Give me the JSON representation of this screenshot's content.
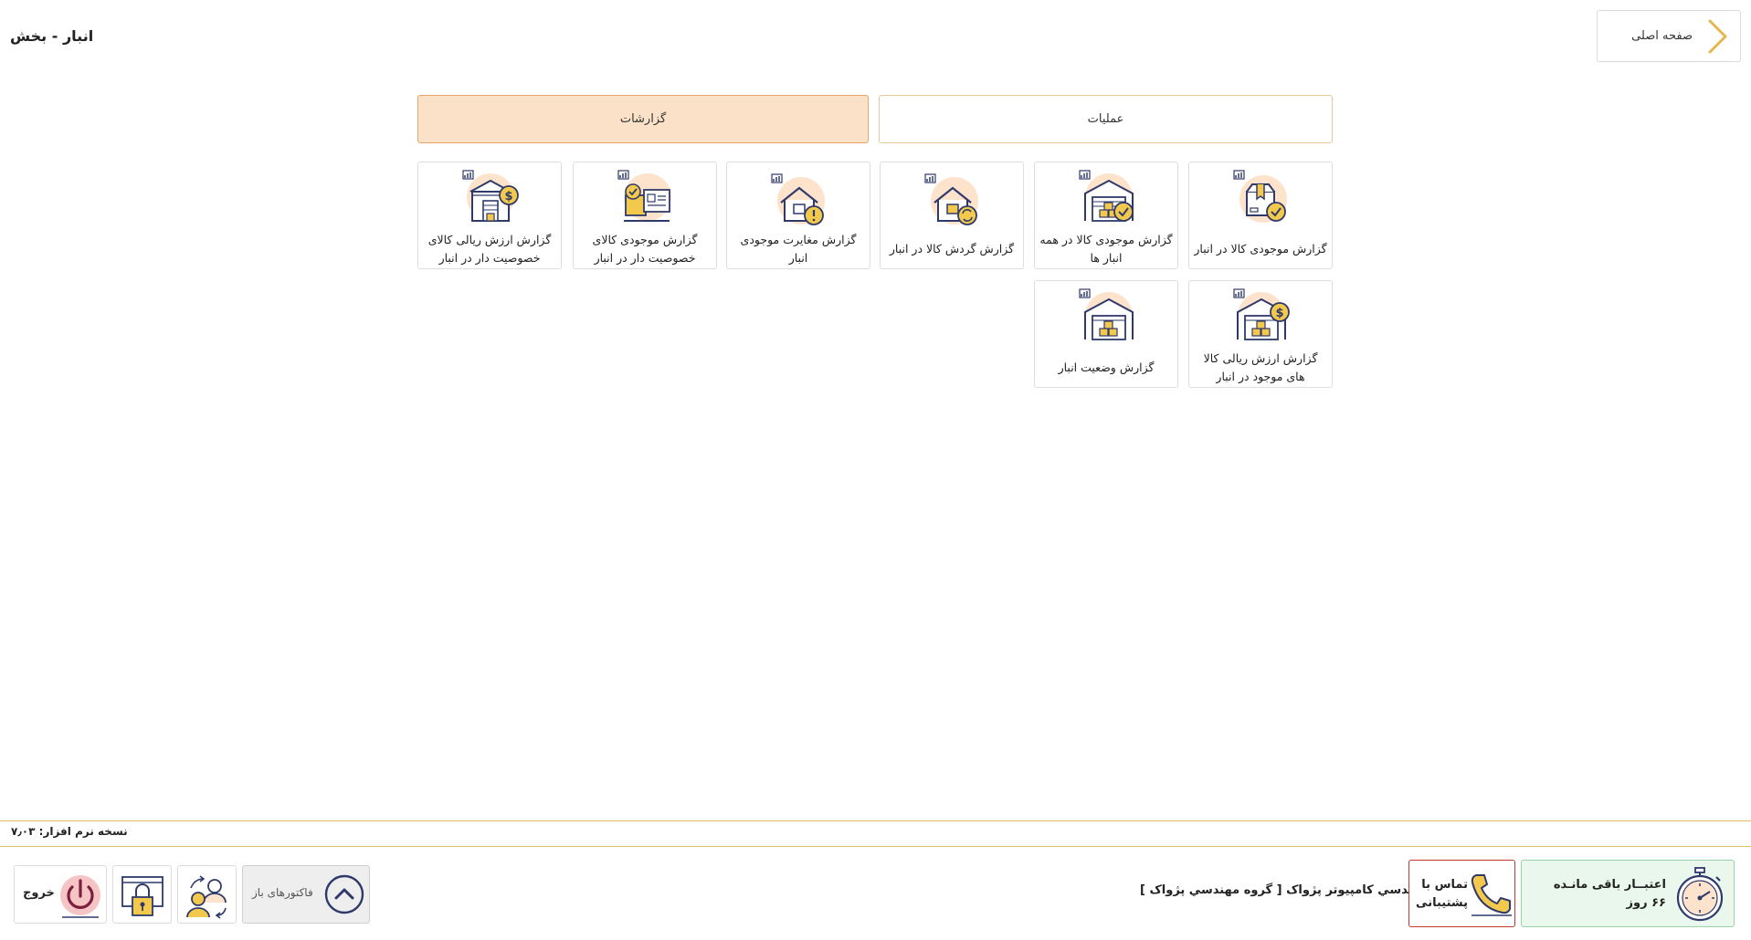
{
  "header": {
    "page_title": "انبار - بخش",
    "home_label": "صفحه اصلی"
  },
  "tabs": {
    "reports": "گزارشات",
    "operations": "عملیات"
  },
  "cards": [
    {
      "label": "گزارش موجودی کالا در انبار",
      "icon": "box-check-icon"
    },
    {
      "label": "گزارش موجودی کالا در همه انبار ها",
      "icon": "warehouse-check-icon"
    },
    {
      "label": "گزارش گردش کالا در انبار",
      "icon": "warehouse-cycle-icon"
    },
    {
      "label": "گزارش مغایرت موجودی انبار",
      "icon": "warehouse-alert-icon"
    },
    {
      "label": "گزارش موجودی کالای خصوصیت دار در انبار",
      "icon": "package-spec-icon"
    },
    {
      "label": "گزارش ارزش ریالی کالای خصوصیت دار در انبار",
      "icon": "store-dollar-icon"
    },
    {
      "label": "گزارش ارزش ریالی کالا های موجود در انبار",
      "icon": "warehouse-dollar-icon"
    },
    {
      "label": "گزارش وضعیت انبار",
      "icon": "warehouse-status-icon"
    }
  ],
  "footer": {
    "version": "نسخه نرم افزار: ۷٫۰۳",
    "exit_label": "خروج",
    "open_invoices_label": "فاکتورهای باز",
    "company": "شرکت مهندسي کامپيوتر پژواک [ گروه مهندسي پژواک ]",
    "support_label": "تماس با پشتیبانی",
    "credit_label": "اعتبــار باقی مانـده ۶۶ روز"
  },
  "colors": {
    "accent": "#e7a56d",
    "accent_bg": "#fbe1c8",
    "icon_circle": "#fde3cc",
    "icon_stroke": "#2f3a6b",
    "icon_gold": "#f2c94c",
    "success_bg": "#e9f7ec",
    "danger_border": "#c0392b"
  }
}
